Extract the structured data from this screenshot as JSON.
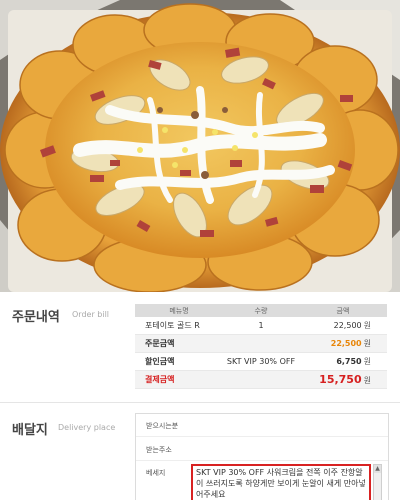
{
  "order_bill": {
    "title": "주문내역",
    "subtitle": "Order bill",
    "columns": [
      "메뉴명",
      "수량",
      "금액"
    ],
    "item": {
      "name": "포테이토 골드 R",
      "qty": "1",
      "amount": "22,500",
      "unit": "원"
    },
    "order_total": {
      "label": "주문금액",
      "amount": "22,500",
      "unit": "원"
    },
    "discount": {
      "label": "할인금액",
      "note": "SKT VIP 30% OFF",
      "amount": "6,750",
      "unit": "원"
    },
    "payment": {
      "label": "결제금액",
      "amount": "15,750",
      "unit": "원"
    }
  },
  "delivery": {
    "title": "배달지",
    "subtitle": "Delivery place",
    "recipient_label": "받으시는분",
    "address_label": "받는주소",
    "memo_label": "베세지",
    "memo_text": "SKT VIP 30% OFF 사워크림을 전쪽 이주 잔항알이 쓰러지도록 하양게만 보이게 눈알이 새게 만아넣어주세요"
  },
  "colors": {
    "accent_orange": "#e8860a",
    "accent_red": "#d62020",
    "memo_border": "#d82222",
    "header_gray": "#dcdcdc"
  }
}
